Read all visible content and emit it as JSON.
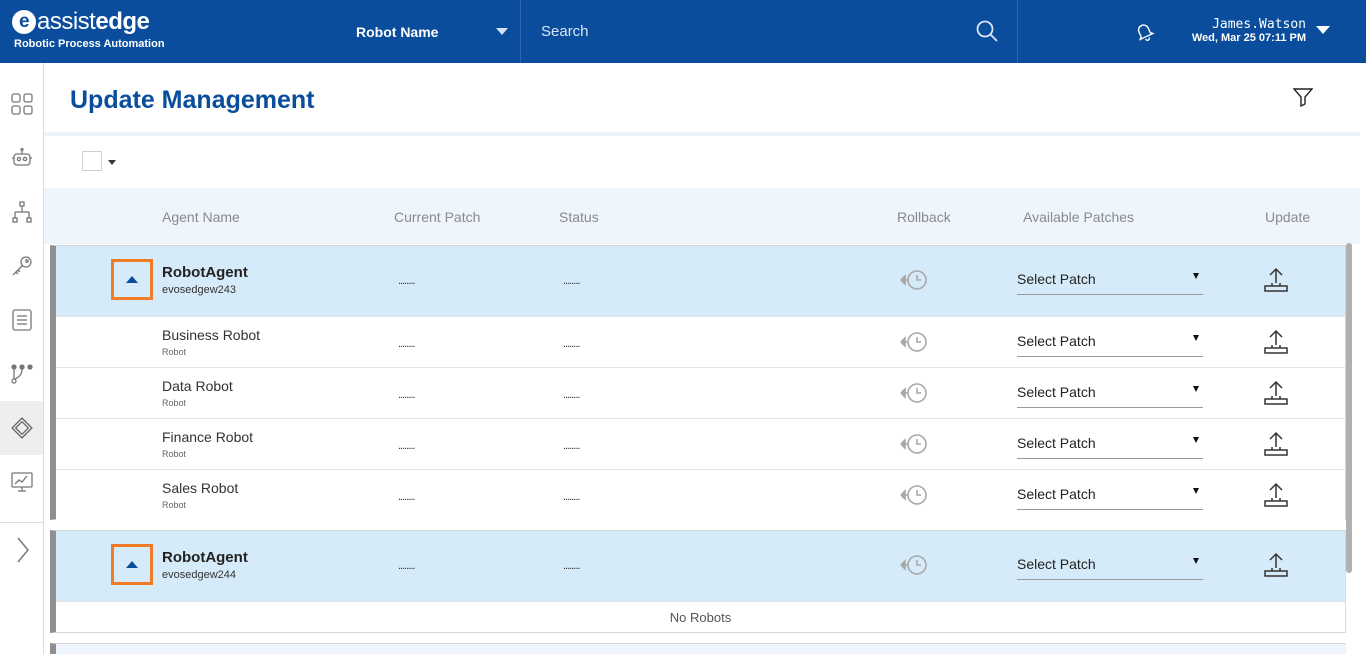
{
  "header": {
    "logo_assist": "assist",
    "logo_edge": "edge",
    "logo_letter": "e",
    "logo_sub": "Robotic Process Automation",
    "robot_select": "Robot Name",
    "search_placeholder": "Search",
    "user_name": "James.Watson",
    "user_time": "Wed, Mar 25 07:11 PM"
  },
  "sidebar": {
    "items": [
      "dashboard",
      "robots",
      "hierarchy",
      "credentials",
      "logs",
      "workflows",
      "update-management",
      "monitoring"
    ],
    "active": "update-management"
  },
  "page": {
    "title": "Update Management"
  },
  "table": {
    "columns": {
      "agent_name": "Agent Name",
      "current_patch": "Current Patch",
      "status": "Status",
      "rollback": "Rollback",
      "available_patches": "Available Patches",
      "update": "Update"
    },
    "placeholder_value": "........",
    "patch_select_label": "Select Patch",
    "groups": [
      {
        "agent": "RobotAgent",
        "host": "evosedgew243",
        "current_patch": "........",
        "status": "........",
        "robots": [
          {
            "name": "Business Robot",
            "type": "Robot",
            "current_patch": "........",
            "status": "........"
          },
          {
            "name": "Data Robot",
            "type": "Robot",
            "current_patch": "........",
            "status": "........"
          },
          {
            "name": "Finance Robot",
            "type": "Robot",
            "current_patch": "........",
            "status": "........"
          },
          {
            "name": "Sales Robot",
            "type": "Robot",
            "current_patch": "........",
            "status": "........"
          }
        ]
      },
      {
        "agent": "RobotAgent",
        "host": "evosedgew244",
        "current_patch": "........",
        "status": "........",
        "robots": [],
        "empty_text": "No Robots"
      }
    ]
  },
  "colors": {
    "header_bg": "#0a4d9c",
    "agent_row_bg": "#d6ebf9",
    "highlight_border": "#f07c27",
    "title_color": "#0a4d9c"
  }
}
